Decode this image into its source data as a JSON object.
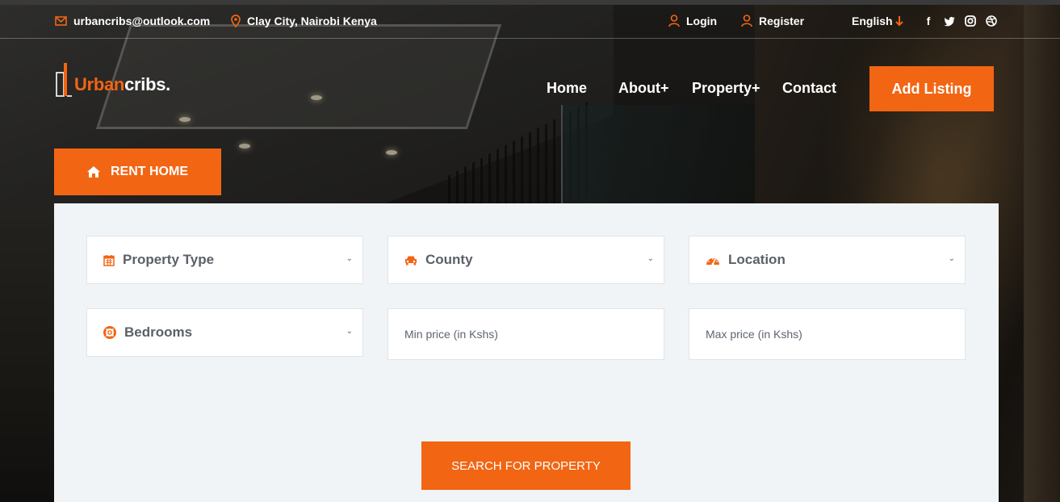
{
  "topbar": {
    "email": "urbancribs@outlook.com",
    "location": "Clay City, Nairobi Kenya",
    "login_label": "Login",
    "register_label": "Register",
    "language_label": "English",
    "social": [
      "facebook-icon",
      "twitter-icon",
      "instagram-icon",
      "dribbble-icon"
    ]
  },
  "brand": {
    "logo_part1": "Urban",
    "logo_part2": "cribs."
  },
  "nav": {
    "items": [
      {
        "label": "Home"
      },
      {
        "label": "About+"
      },
      {
        "label": "Property+"
      },
      {
        "label": "Contact"
      }
    ],
    "cta_label": "Add Listing"
  },
  "search": {
    "tab_label": "RENT HOME",
    "property_type": "Property Type",
    "county": "County",
    "location": "Location",
    "bedrooms": "Bedrooms",
    "min_price_placeholder": "Min price (in Kshs)",
    "max_price_placeholder": "Max price (in Kshs)",
    "submit_label": "SEARCH FOR PROPERTY"
  },
  "colors": {
    "accent": "#f26513",
    "panel_bg": "#f0f4f6",
    "field_bg": "#ffffff"
  }
}
